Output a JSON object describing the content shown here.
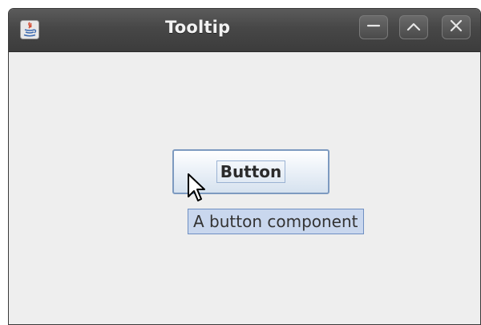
{
  "window": {
    "title": "Tooltip",
    "app_icon": "java-icon",
    "controls": [
      "minimize-icon",
      "maximize-icon",
      "close-icon"
    ]
  },
  "content": {
    "button_label": "Button",
    "tooltip_text": "A button component"
  },
  "colors": {
    "titlebar": "#474747",
    "content_bg": "#eeeeee",
    "button_border": "#7d9ac0",
    "tooltip_bg": "#c9d7ee",
    "tooltip_border": "#6f8fc2"
  }
}
